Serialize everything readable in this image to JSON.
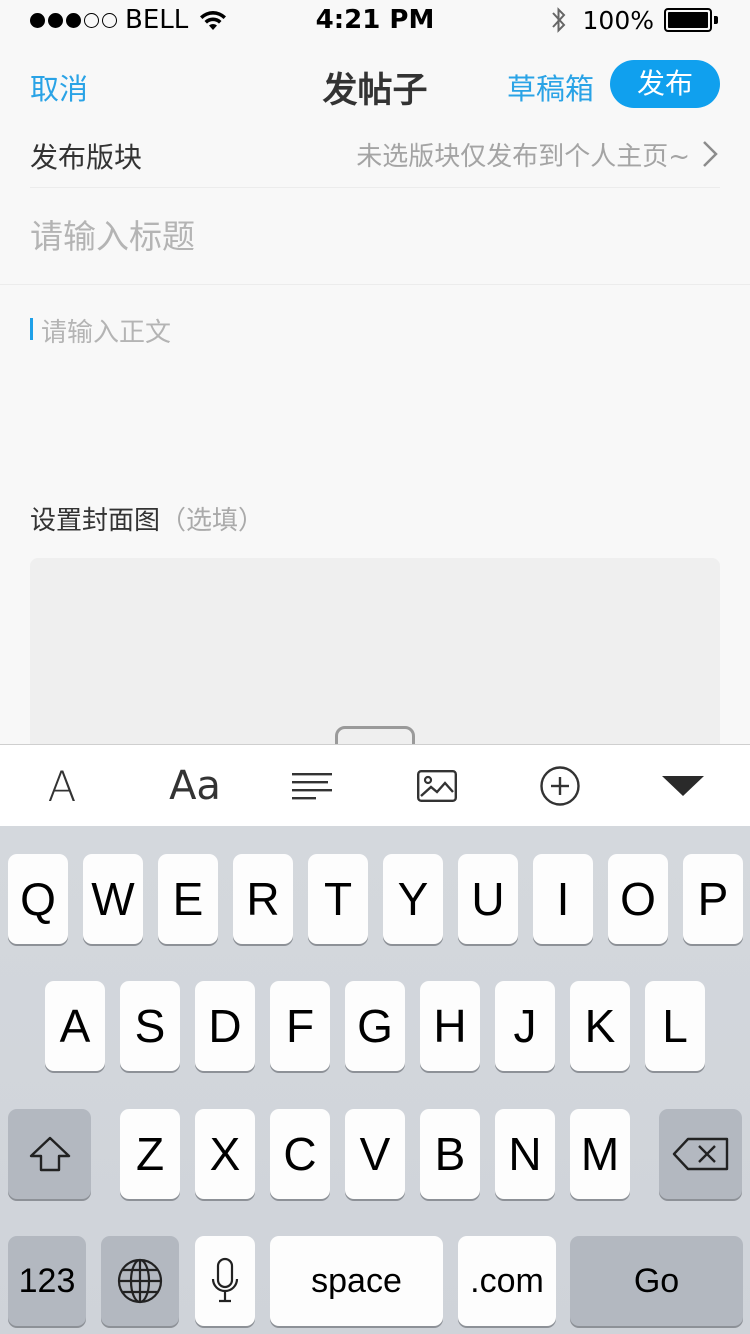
{
  "status_bar": {
    "carrier": "BELL",
    "time": "4:21 PM",
    "battery": "100%",
    "signal_bars_filled": 3,
    "signal_bars_total": 5
  },
  "nav": {
    "cancel": "取消",
    "title": "发帖子",
    "drafts": "草稿箱",
    "publish": "发布"
  },
  "section": {
    "label": "发布版块",
    "value": "未选版块仅发布到个人主页~"
  },
  "title_input": {
    "placeholder": "请输入标题"
  },
  "body_input": {
    "placeholder": "请输入正文"
  },
  "cover": {
    "label": "设置封面图",
    "optional": "（选填）"
  },
  "toolbar": {
    "font": "A",
    "font_size": "Aa",
    "icons": [
      "font-icon",
      "font-size-icon",
      "align-left-icon",
      "image-icon",
      "add-circle-icon",
      "collapse-keyboard-icon"
    ]
  },
  "keyboard": {
    "row1": [
      "Q",
      "W",
      "E",
      "R",
      "T",
      "Y",
      "U",
      "I",
      "O",
      "P"
    ],
    "row2": [
      "A",
      "S",
      "D",
      "F",
      "G",
      "H",
      "J",
      "K",
      "L"
    ],
    "row3": [
      "Z",
      "X",
      "C",
      "V",
      "B",
      "N",
      "M"
    ],
    "numbers": "123",
    "space": "space",
    "dotcom": ".com",
    "go": "Go"
  },
  "colors": {
    "accent": "#10a0ee",
    "link": "#2aa3e6",
    "placeholder": "#b4b4b4"
  }
}
